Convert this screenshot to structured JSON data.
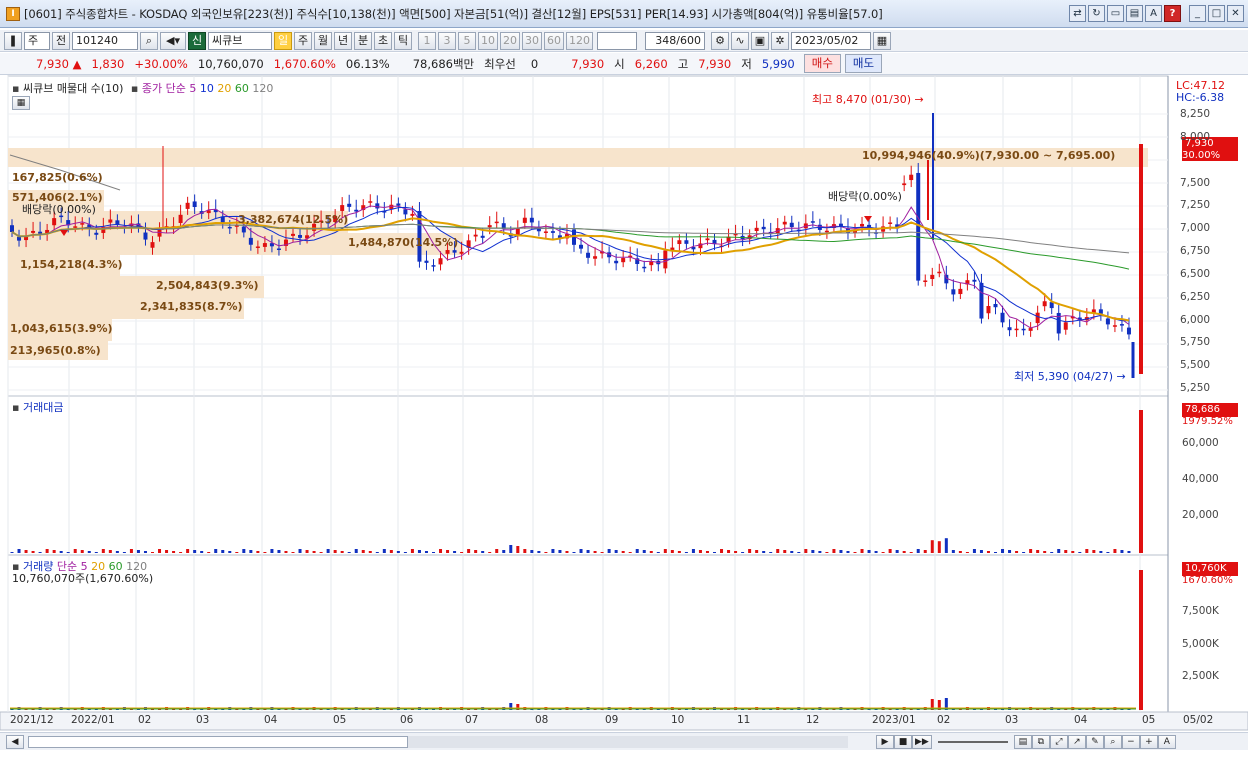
{
  "window": {
    "title": "[0601] 주식종합차트 - KOSDAQ 외국인보유[223(천)] 주식수[10,138(천)] 액면[500] 자본금[51(억)] 결산[12월] EPS[531] PER[14.93] 시가총액[804(억)] 유통비율[57.0]",
    "app_icon": "I"
  },
  "toolbar": {
    "market": "주",
    "type": "전",
    "code": "101240",
    "stock_badge": "신",
    "stock_name": "씨큐브",
    "periods": [
      "일",
      "주",
      "월",
      "년",
      "분",
      "초",
      "틱"
    ],
    "active_period": "일",
    "minute_options": [
      "1",
      "3",
      "5",
      "10",
      "20",
      "30",
      "60",
      "120"
    ],
    "count": "348",
    "count_total": "/600",
    "date": "2023/05/02"
  },
  "quote": {
    "price": "7,930",
    "change": "1,830",
    "change_pct": "+30.00%",
    "volume": "10,760,070",
    "volume_pct": "1,670.60%",
    "turnover": "06.13%",
    "amount": "78,686백만",
    "priority_label": "최우선",
    "priority_value": "0",
    "ask": "7,930",
    "open_label": "시",
    "open": "6,260",
    "high_label": "고",
    "high": "7,930",
    "low_label": "저",
    "low": "5,990",
    "buy": "매수",
    "sell": "매도"
  },
  "price_panel": {
    "title": "씨큐브 매물대 수(10)",
    "ma_label": "종가 단순",
    "ma_periods": [
      "5",
      "10",
      "20",
      "60",
      "120"
    ],
    "ma_colors": [
      "#a020a0",
      "#1030d0",
      "#e0a000",
      "#2a9a2a",
      "#808080"
    ],
    "lc": "LC:47.12",
    "hc": "HC:-6.38",
    "y_ticks": [
      "8,250",
      "8,000",
      "7,750",
      "7,500",
      "7,250",
      "7,000",
      "6,750",
      "6,500",
      "6,250",
      "6,000",
      "5,750",
      "5,500",
      "5,250"
    ],
    "price_box": "7,930",
    "price_box_pct": "30.00%",
    "high_note": "최고 8,470 (01/30)",
    "low_note": "최저 5,390 (04/27)",
    "dividend_1": "배당락(0.00%)",
    "dividend_2": "배당락(0.00%)",
    "volume_profile": [
      "167,825(0.6%)",
      "571,406(2.1%)",
      "3,382,674(12.5%)",
      "1,484,870(14.5%)",
      "1,154,218(4.3%)",
      "2,504,843(9.3%)",
      "2,341,835(8.7%)",
      "1,043,615(3.9%)",
      "213,965(0.8%)",
      "10,994,946(40.9%)(7,930.00 ~ 7,695.00)"
    ]
  },
  "amount_panel": {
    "title": "거래대금",
    "y_ticks": [
      "60,000",
      "40,000",
      "20,000"
    ],
    "value_box": "78,686",
    "value_pct": "1979.52%"
  },
  "volume_panel": {
    "title": "거래량",
    "ma_label": "단순",
    "ma_periods": [
      "5",
      "20",
      "60",
      "120"
    ],
    "value_label": "10,760,070주(1,670.60%)",
    "y_ticks": [
      "7,500K",
      "5,000K",
      "2,500K"
    ],
    "value_box": "10,760K",
    "value_pct": "1670.60%"
  },
  "x_axis": [
    "2021/12",
    "2022/01",
    "02",
    "03",
    "04",
    "05",
    "06",
    "07",
    "08",
    "09",
    "10",
    "11",
    "12",
    "2023/01",
    "02",
    "03",
    "04",
    "05",
    "05/02"
  ],
  "colors": {
    "up": "#e01010",
    "down": "#1030c0",
    "band": "#f7e4cc"
  }
}
